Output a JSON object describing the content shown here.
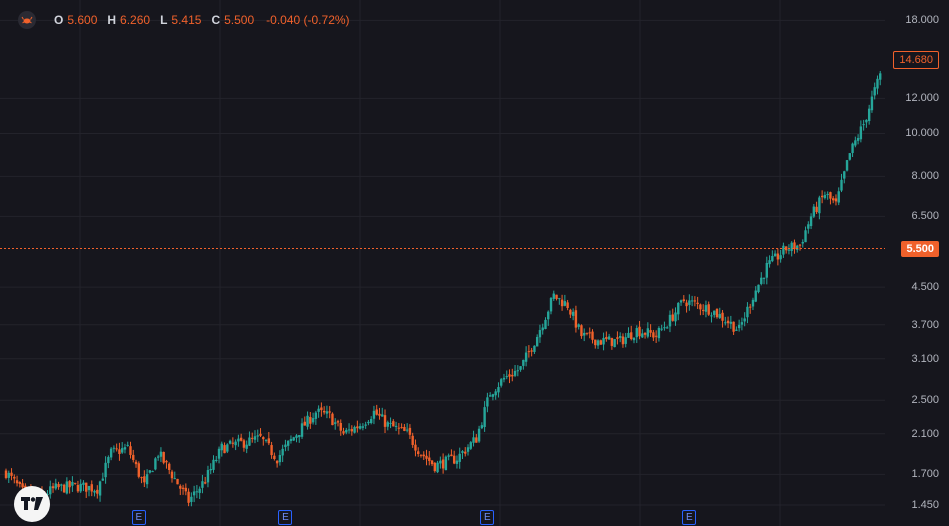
{
  "ohlc": {
    "open_label": "O",
    "open": "5.600",
    "high_label": "H",
    "high": "6.260",
    "low_label": "L",
    "low": "5.415",
    "close_label": "C",
    "close": "5.500",
    "change": "-0.040 (-0.72%)"
  },
  "colors": {
    "background": "#16161d",
    "up": "#26a69a",
    "down": "#f0612b",
    "grid": "#23232b",
    "axis_text": "#b2b5be",
    "earnings": "#2962ff"
  },
  "icons": {
    "symbol": "crab-icon",
    "brand": "tradingview-logo-icon",
    "earnings": "earnings-e-icon"
  },
  "price_axis": {
    "labels": [
      "18.000",
      "12.000",
      "10.000",
      "8.000",
      "6.500",
      "4.500",
      "3.700",
      "3.100",
      "2.500",
      "2.100",
      "1.700",
      "1.450"
    ]
  },
  "price_tags": {
    "high": "14.680",
    "last": "5.500"
  },
  "earnings_markers": [
    "E",
    "E",
    "E",
    "E"
  ],
  "brand": {
    "logo_text": "TV"
  },
  "chart_data": {
    "type": "candlestick",
    "scale": "log",
    "ylim": [
      1.3,
      19.0
    ],
    "last_price": 5.5,
    "high_marker": 14.68,
    "earnings_bar_index": [
      48,
      101,
      174,
      247
    ],
    "close_path": [
      [
        0,
        1.72
      ],
      [
        6,
        1.55
      ],
      [
        12,
        1.52
      ],
      [
        18,
        1.58
      ],
      [
        25,
        1.6
      ],
      [
        33,
        1.58
      ],
      [
        38,
        1.9
      ],
      [
        44,
        1.95
      ],
      [
        50,
        1.6
      ],
      [
        55,
        1.9
      ],
      [
        60,
        1.7
      ],
      [
        66,
        1.48
      ],
      [
        72,
        1.65
      ],
      [
        78,
        1.95
      ],
      [
        85,
        2.0
      ],
      [
        92,
        2.05
      ],
      [
        98,
        1.85
      ],
      [
        105,
        2.1
      ],
      [
        112,
        2.35
      ],
      [
        117,
        2.3
      ],
      [
        122,
        2.1
      ],
      [
        128,
        2.2
      ],
      [
        133,
        2.35
      ],
      [
        138,
        2.2
      ],
      [
        145,
        2.1
      ],
      [
        150,
        1.9
      ],
      [
        155,
        1.78
      ],
      [
        163,
        1.85
      ],
      [
        170,
        2.05
      ],
      [
        175,
        2.6
      ],
      [
        180,
        2.8
      ],
      [
        186,
        2.95
      ],
      [
        192,
        3.5
      ],
      [
        198,
        4.3
      ],
      [
        203,
        4.1
      ],
      [
        208,
        3.5
      ],
      [
        215,
        3.4
      ],
      [
        222,
        3.4
      ],
      [
        228,
        3.6
      ],
      [
        235,
        3.5
      ],
      [
        240,
        3.8
      ],
      [
        245,
        4.2
      ],
      [
        250,
        4.1
      ],
      [
        255,
        4.0
      ],
      [
        260,
        3.8
      ],
      [
        265,
        3.6
      ],
      [
        270,
        4.3
      ],
      [
        275,
        5.0
      ],
      [
        282,
        5.5
      ],
      [
        287,
        5.6
      ],
      [
        291,
        6.5
      ],
      [
        296,
        7.3
      ],
      [
        300,
        6.9
      ],
      [
        305,
        9.0
      ],
      [
        310,
        10.5
      ],
      [
        314,
        12.5
      ],
      [
        316,
        13.5
      ]
    ]
  }
}
